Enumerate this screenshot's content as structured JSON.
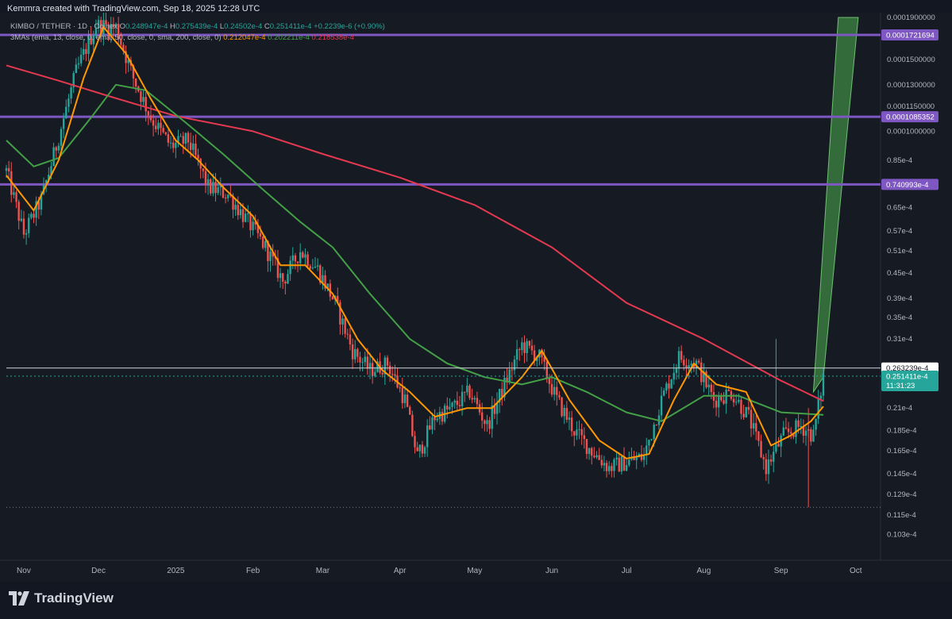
{
  "header": {
    "credit": "Kemmra created with TradingView.com, Sep 18, 2025 12:28 UTC"
  },
  "legend": {
    "symbol": "KIMBO / TETHER · 1D · Coinex",
    "o_label": "O",
    "o_value": "0.248947e-4",
    "h_label": "H",
    "h_value": "0.275439e-4",
    "l_label": "L",
    "l_value": "0.24502e-4",
    "c_label": "C",
    "c_value": "0.251411e-4",
    "change": "+0.2239e-6 (+0.90%)",
    "ma_label": "3MAs (ema, 13, close, 0, ema, 50, close, 0, sma, 200, close, 0)",
    "ma1_value": "0.212047e-4",
    "ma2_value": "0.202211e-4",
    "ma3_value": "0.218538e-4"
  },
  "footer": {
    "brand": "TradingView"
  },
  "colors": {
    "background": "#161a23",
    "up": "#26a69a",
    "down": "#ef5350",
    "ema13": "#ff9800",
    "ema50": "#43a047",
    "sma200": "#e53950",
    "level": "#7e57c2",
    "projection": "#4caf50"
  },
  "chart_data": {
    "type": "candlestick",
    "title": "KIMBO / TETHER · 1D · Coinex",
    "scale": "log",
    "ylim": [
      1e-05,
      0.00019
    ],
    "x_ticks": [
      "Nov",
      "Dec",
      "2025",
      "Feb",
      "Mar",
      "Apr",
      "May",
      "Jun",
      "Jul",
      "Aug",
      "Sep",
      "Oct"
    ],
    "y_ticks": [
      "0.0001900000",
      "0.0001500000",
      "0.0001300000",
      "0.0001150000",
      "0.0001000000",
      "0.85e-4",
      "0.65e-4",
      "0.57e-4",
      "0.51e-4",
      "0.45e-4",
      "0.39e-4",
      "0.35e-4",
      "0.31e-4",
      "0.21e-4",
      "0.185e-4",
      "0.165e-4",
      "0.145e-4",
      "0.129e-4",
      "0.115e-4",
      "0.103e-4"
    ],
    "y_tick_values": [
      0.00019,
      0.00015,
      0.00013,
      0.000115,
      0.0001,
      8.5e-05,
      6.5e-05,
      5.7e-05,
      5.1e-05,
      4.5e-05,
      3.9e-05,
      3.5e-05,
      3.1e-05,
      2.1e-05,
      1.85e-05,
      1.65e-05,
      1.45e-05,
      1.29e-05,
      1.15e-05,
      1.03e-05
    ],
    "levels": [
      {
        "value": 0.0001721694,
        "label": "0.0001721694"
      },
      {
        "value": 0.0001085352,
        "label": "0.0001085352"
      },
      {
        "value": 7.40993e-05,
        "label": "0.740993e-4"
      }
    ],
    "high_marker": {
      "value": 2.63239e-05,
      "label": "0.263239e-4"
    },
    "last_price": {
      "value": 2.51411e-05,
      "label": "0.251411e-4",
      "countdown": "11:31:23"
    },
    "low_marker_value": 1.2e-05,
    "close_path": [
      {
        "date": "2024-10-25",
        "value": 8e-05
      },
      {
        "date": "2024-11-01",
        "value": 5.6e-05
      },
      {
        "date": "2024-11-08",
        "value": 6.8e-05
      },
      {
        "date": "2024-11-14",
        "value": 9.2e-05
      },
      {
        "date": "2024-11-22",
        "value": 0.00014
      },
      {
        "date": "2024-11-30",
        "value": 0.000182
      },
      {
        "date": "2024-12-08",
        "value": 0.00018
      },
      {
        "date": "2024-12-15",
        "value": 0.000135
      },
      {
        "date": "2024-12-22",
        "value": 0.000108
      },
      {
        "date": "2024-12-30",
        "value": 9.2e-05
      },
      {
        "date": "2025-01-06",
        "value": 9.5e-05
      },
      {
        "date": "2025-01-14",
        "value": 7.3e-05
      },
      {
        "date": "2025-01-22",
        "value": 7e-05
      },
      {
        "date": "2025-01-30",
        "value": 6e-05
      },
      {
        "date": "2025-02-06",
        "value": 5.2e-05
      },
      {
        "date": "2025-02-13",
        "value": 4.3e-05
      },
      {
        "date": "2025-02-20",
        "value": 5.1e-05
      },
      {
        "date": "2025-02-27",
        "value": 4.6e-05
      },
      {
        "date": "2025-03-06",
        "value": 3.8e-05
      },
      {
        "date": "2025-03-13",
        "value": 2.9e-05
      },
      {
        "date": "2025-03-20",
        "value": 2.6e-05
      },
      {
        "date": "2025-03-27",
        "value": 2.7e-05
      },
      {
        "date": "2025-04-03",
        "value": 2.2e-05
      },
      {
        "date": "2025-04-08",
        "value": 1.6e-05
      },
      {
        "date": "2025-04-15",
        "value": 2e-05
      },
      {
        "date": "2025-04-22",
        "value": 2.1e-05
      },
      {
        "date": "2025-04-29",
        "value": 2.3e-05
      },
      {
        "date": "2025-05-06",
        "value": 1.9e-05
      },
      {
        "date": "2025-05-13",
        "value": 2.4e-05
      },
      {
        "date": "2025-05-20",
        "value": 3e-05
      },
      {
        "date": "2025-05-27",
        "value": 2.8e-05
      },
      {
        "date": "2025-06-03",
        "value": 2.2e-05
      },
      {
        "date": "2025-06-10",
        "value": 1.85e-05
      },
      {
        "date": "2025-06-17",
        "value": 1.65e-05
      },
      {
        "date": "2025-06-24",
        "value": 1.5e-05
      },
      {
        "date": "2025-07-01",
        "value": 1.55e-05
      },
      {
        "date": "2025-07-08",
        "value": 1.6e-05
      },
      {
        "date": "2025-07-15",
        "value": 2.2e-05
      },
      {
        "date": "2025-07-22",
        "value": 2.8e-05
      },
      {
        "date": "2025-07-29",
        "value": 2.7e-05
      },
      {
        "date": "2025-08-05",
        "value": 2.2e-05
      },
      {
        "date": "2025-08-12",
        "value": 2.3e-05
      },
      {
        "date": "2025-08-19",
        "value": 2e-05
      },
      {
        "date": "2025-08-26",
        "value": 1.5e-05
      },
      {
        "date": "2025-09-02",
        "value": 1.8e-05
      },
      {
        "date": "2025-09-09",
        "value": 1.9e-05
      },
      {
        "date": "2025-09-14",
        "value": 1.8e-05
      },
      {
        "date": "2025-09-18",
        "value": 2.514e-05
      }
    ],
    "ema13": [
      {
        "date": "2024-10-25",
        "value": 7.8e-05
      },
      {
        "date": "2024-11-05",
        "value": 6.4e-05
      },
      {
        "date": "2024-11-15",
        "value": 8.5e-05
      },
      {
        "date": "2024-11-25",
        "value": 0.000135
      },
      {
        "date": "2024-12-03",
        "value": 0.00018
      },
      {
        "date": "2024-12-12",
        "value": 0.000155
      },
      {
        "date": "2024-12-22",
        "value": 0.00012
      },
      {
        "date": "2025-01-01",
        "value": 9.5e-05
      },
      {
        "date": "2025-01-10",
        "value": 8.5e-05
      },
      {
        "date": "2025-01-20",
        "value": 7.3e-05
      },
      {
        "date": "2025-02-01",
        "value": 6.2e-05
      },
      {
        "date": "2025-02-12",
        "value": 4.7e-05
      },
      {
        "date": "2025-02-22",
        "value": 4.7e-05
      },
      {
        "date": "2025-03-05",
        "value": 4e-05
      },
      {
        "date": "2025-03-15",
        "value": 3.1e-05
      },
      {
        "date": "2025-03-25",
        "value": 2.6e-05
      },
      {
        "date": "2025-04-05",
        "value": 2.3e-05
      },
      {
        "date": "2025-04-15",
        "value": 2e-05
      },
      {
        "date": "2025-04-28",
        "value": 2.1e-05
      },
      {
        "date": "2025-05-08",
        "value": 2.1e-05
      },
      {
        "date": "2025-05-20",
        "value": 2.5e-05
      },
      {
        "date": "2025-05-28",
        "value": 2.9e-05
      },
      {
        "date": "2025-06-08",
        "value": 2.2e-05
      },
      {
        "date": "2025-06-20",
        "value": 1.75e-05
      },
      {
        "date": "2025-07-01",
        "value": 1.58e-05
      },
      {
        "date": "2025-07-10",
        "value": 1.62e-05
      },
      {
        "date": "2025-07-20",
        "value": 2.2e-05
      },
      {
        "date": "2025-07-28",
        "value": 2.7e-05
      },
      {
        "date": "2025-08-06",
        "value": 2.4e-05
      },
      {
        "date": "2025-08-18",
        "value": 2.3e-05
      },
      {
        "date": "2025-08-28",
        "value": 1.7e-05
      },
      {
        "date": "2025-09-05",
        "value": 1.8e-05
      },
      {
        "date": "2025-09-13",
        "value": 1.95e-05
      },
      {
        "date": "2025-09-18",
        "value": 2.12e-05
      }
    ],
    "ema50": [
      {
        "date": "2024-10-25",
        "value": 9.5e-05
      },
      {
        "date": "2024-11-05",
        "value": 8.2e-05
      },
      {
        "date": "2024-11-15",
        "value": 8.6e-05
      },
      {
        "date": "2024-11-28",
        "value": 0.000108
      },
      {
        "date": "2024-12-08",
        "value": 0.00013
      },
      {
        "date": "2024-12-20",
        "value": 0.000126
      },
      {
        "date": "2025-01-05",
        "value": 0.000105
      },
      {
        "date": "2025-01-20",
        "value": 8.8e-05
      },
      {
        "date": "2025-02-05",
        "value": 7.2e-05
      },
      {
        "date": "2025-02-20",
        "value": 6e-05
      },
      {
        "date": "2025-03-05",
        "value": 5.2e-05
      },
      {
        "date": "2025-03-20",
        "value": 4e-05
      },
      {
        "date": "2025-04-05",
        "value": 3.1e-05
      },
      {
        "date": "2025-04-20",
        "value": 2.7e-05
      },
      {
        "date": "2025-05-05",
        "value": 2.5e-05
      },
      {
        "date": "2025-05-20",
        "value": 2.4e-05
      },
      {
        "date": "2025-06-01",
        "value": 2.5e-05
      },
      {
        "date": "2025-06-15",
        "value": 2.3e-05
      },
      {
        "date": "2025-07-01",
        "value": 2.05e-05
      },
      {
        "date": "2025-07-15",
        "value": 1.95e-05
      },
      {
        "date": "2025-08-01",
        "value": 2.25e-05
      },
      {
        "date": "2025-08-15",
        "value": 2.25e-05
      },
      {
        "date": "2025-09-01",
        "value": 2.05e-05
      },
      {
        "date": "2025-09-18",
        "value": 2.022e-05
      }
    ],
    "sma200": [
      {
        "date": "2024-10-25",
        "value": 0.000145
      },
      {
        "date": "2024-11-15",
        "value": 0.000133
      },
      {
        "date": "2024-12-05",
        "value": 0.000122
      },
      {
        "date": "2025-01-01",
        "value": 0.000109
      },
      {
        "date": "2025-02-01",
        "value": 0.0001
      },
      {
        "date": "2025-03-01",
        "value": 8.8e-05
      },
      {
        "date": "2025-04-01",
        "value": 7.7e-05
      },
      {
        "date": "2025-05-01",
        "value": 6.6e-05
      },
      {
        "date": "2025-06-01",
        "value": 5.2e-05
      },
      {
        "date": "2025-07-01",
        "value": 3.8e-05
      },
      {
        "date": "2025-08-01",
        "value": 3.1e-05
      },
      {
        "date": "2025-09-01",
        "value": 2.45e-05
      },
      {
        "date": "2025-09-18",
        "value": 2.185e-05
      }
    ],
    "projection_wedge": [
      {
        "date": "2025-09-14",
        "value": 2.3e-05
      },
      {
        "date": "2025-09-24",
        "value": 0.00019
      },
      {
        "date": "2025-10-02",
        "value": 0.00019
      },
      {
        "date": "2025-09-18",
        "value": 2.5e-05
      }
    ]
  }
}
